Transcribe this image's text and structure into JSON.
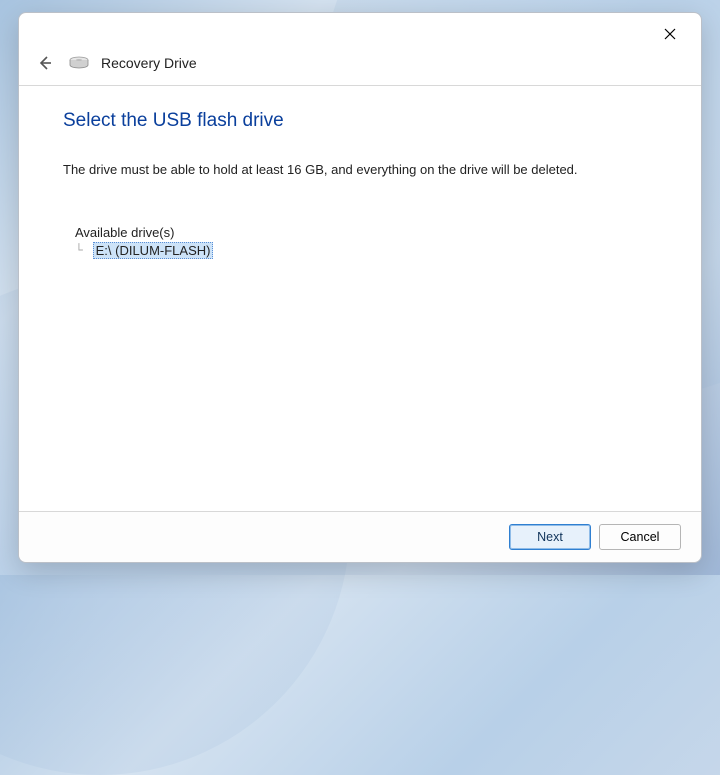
{
  "window": {
    "wizard_title": "Recovery Drive"
  },
  "content": {
    "heading": "Select the USB flash drive",
    "instruction": "The drive must be able to hold at least 16 GB, and everything on the drive will be deleted.",
    "drives_label": "Available drive(s)",
    "drives": [
      {
        "label": "E:\\ (DILUM-FLASH)",
        "selected": true
      }
    ]
  },
  "footer": {
    "next_label": "Next",
    "cancel_label": "Cancel"
  }
}
